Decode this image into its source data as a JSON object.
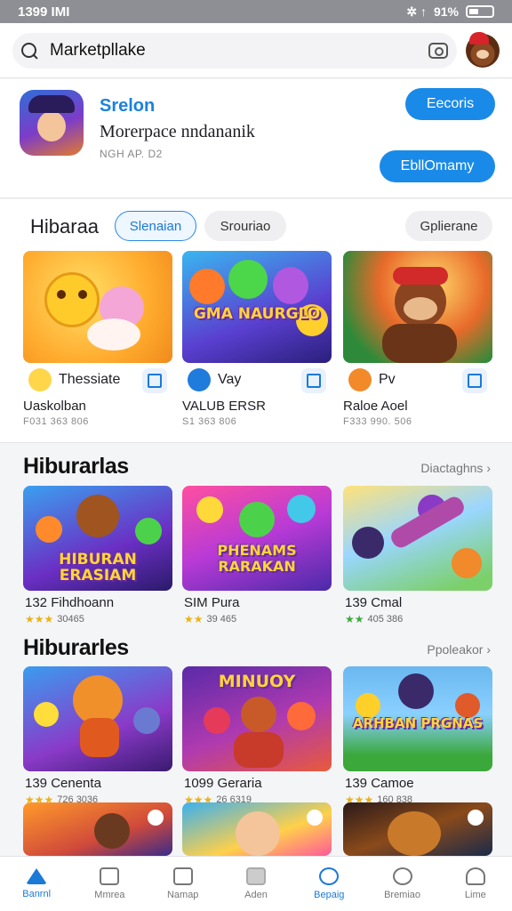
{
  "status": {
    "time": "1399 IMI",
    "battery": "91%",
    "icons": "✲ ↑"
  },
  "search": {
    "value": "Marketpllake"
  },
  "featured": {
    "title": "Srelon",
    "subtitle": "Morerpace nndananik",
    "meta": "NGH AP. D2",
    "button_top": "Eecoris",
    "button_bottom": "EbllOmamy"
  },
  "section1": {
    "label": "Hibaraa",
    "chip_active": "Slenaian",
    "chip": "Srouriao",
    "chip_right": "Gplierane",
    "cards": [
      {
        "app": "Thessiate",
        "name": "Uaskolban",
        "sub": "F031 363 806",
        "thumb_text": ""
      },
      {
        "app": "Vay",
        "name": "VALUB ERSR",
        "sub": "S1 363 806",
        "thumb_text": "GMA NAURGLO"
      },
      {
        "app": "Pv",
        "name": "Raloe Aoel",
        "sub": "F333 990. 506",
        "thumb_text": ""
      }
    ]
  },
  "section2": {
    "title": "Hiburarlas",
    "link": "Diactaghns",
    "cards": [
      {
        "name": "132 Fihdhoann",
        "rating": "30465",
        "thumb_text": "HIBURAN ERASIAM"
      },
      {
        "name": "SIM Pura",
        "rating": "39 465",
        "thumb_text": "PHENAMS RARAKAN"
      },
      {
        "name": "139 Cmal",
        "rating": "405 386",
        "thumb_text": ""
      }
    ]
  },
  "section3": {
    "title": "Hiburarles",
    "link": "Ppoleakor",
    "cards": [
      {
        "name": "139 Cenenta",
        "rating": "726 3036",
        "thumb_text": ""
      },
      {
        "name": "1099 Geraria",
        "rating": "26 6319",
        "thumb_text": "MINUOY"
      },
      {
        "name": "139 Camoe",
        "rating": "160 838",
        "thumb_text": "ARHBAN PRGNAS"
      }
    ]
  },
  "nav": [
    {
      "label": "Banrnl",
      "icon": "home-icon"
    },
    {
      "label": "Mmrea",
      "icon": "list-icon"
    },
    {
      "label": "Namap",
      "icon": "map-icon"
    },
    {
      "label": "Aden",
      "icon": "tools-icon"
    },
    {
      "label": "Bepaig",
      "icon": "chat-icon"
    },
    {
      "label": "Bremiao",
      "icon": "heart-icon"
    },
    {
      "label": "Lime",
      "icon": "user-icon"
    }
  ],
  "colors": {
    "accent": "#1a8ae8",
    "star": "#e8b31b"
  }
}
